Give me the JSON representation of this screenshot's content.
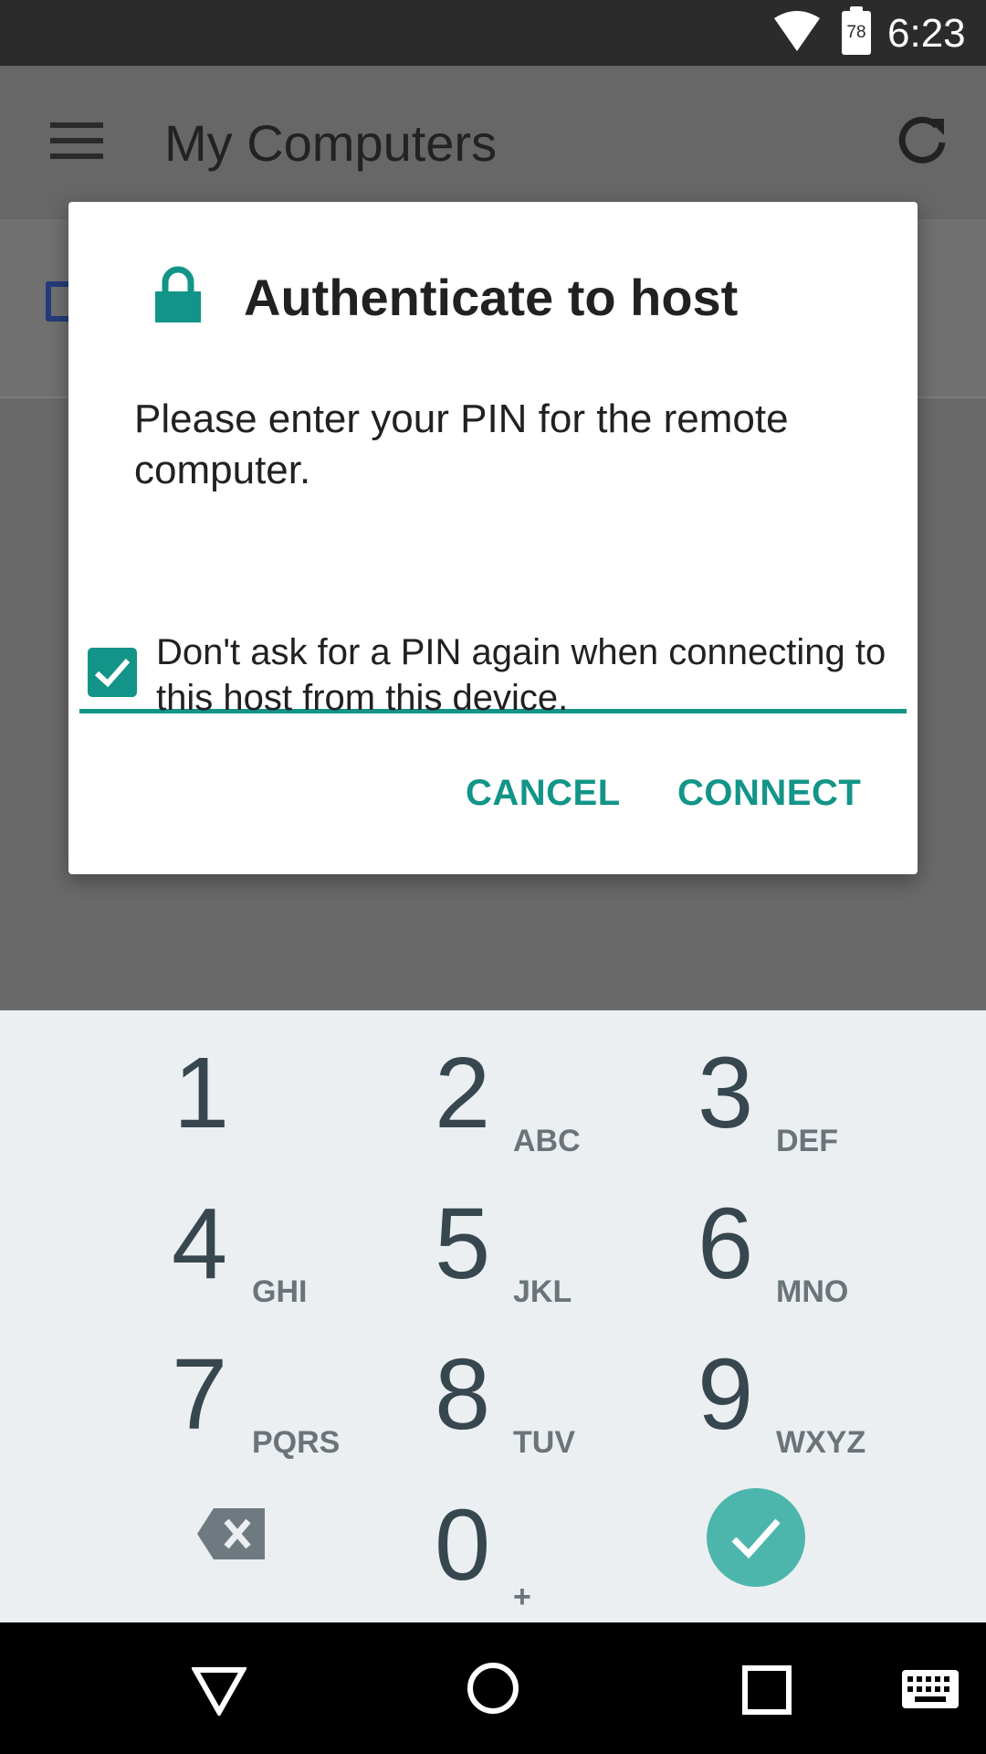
{
  "status_bar": {
    "time": "6:23",
    "battery_level": "78",
    "icons": [
      "wifi-icon",
      "battery-icon"
    ]
  },
  "app_bar": {
    "title": "My Computers",
    "icons": [
      "menu-icon",
      "refresh-icon"
    ]
  },
  "dialog": {
    "title": "Authenticate to host",
    "icon": "lock-icon",
    "message": "Please enter your PIN for the remote computer.",
    "pin_value": "",
    "checkbox_checked": true,
    "checkbox_label_line1": "Don't ask for a PIN again when connecting to",
    "checkbox_label_line2": "this host from this device.",
    "cancel_label": "CANCEL",
    "connect_label": "CONNECT"
  },
  "keypad": {
    "keys": [
      {
        "digit": "1",
        "letters": ""
      },
      {
        "digit": "2",
        "letters": "ABC"
      },
      {
        "digit": "3",
        "letters": "DEF"
      },
      {
        "digit": "4",
        "letters": "GHI"
      },
      {
        "digit": "5",
        "letters": "JKL"
      },
      {
        "digit": "6",
        "letters": "MNO"
      },
      {
        "digit": "7",
        "letters": "PQRS"
      },
      {
        "digit": "8",
        "letters": "TUV"
      },
      {
        "digit": "9",
        "letters": "WXYZ"
      },
      {
        "digit": "0",
        "letters": "+"
      }
    ],
    "icons": [
      "backspace-icon",
      "check-icon"
    ]
  },
  "colors": {
    "accent": "#129588",
    "done_button": "#4db6ac",
    "keypad_bg": "#eceff1",
    "digit": "#37474f"
  },
  "nav_bar": {
    "icons": [
      "back-icon",
      "home-icon",
      "recents-icon",
      "keyboard-icon"
    ]
  }
}
